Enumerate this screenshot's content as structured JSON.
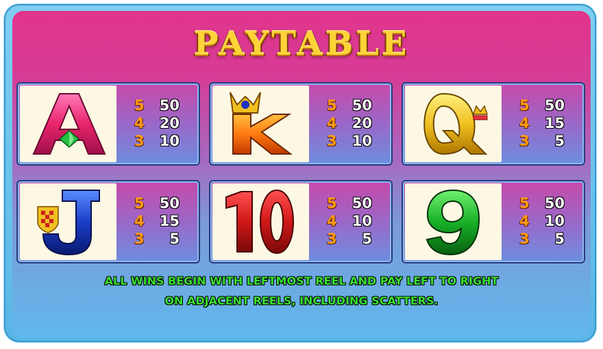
{
  "title": "PAYTABLE",
  "symbols": [
    {
      "name": "A",
      "icon": "ace-icon",
      "color": "#e8246c",
      "pays": [
        {
          "count": "5",
          "amount": "50"
        },
        {
          "count": "4",
          "amount": "20"
        },
        {
          "count": "3",
          "amount": "10"
        }
      ]
    },
    {
      "name": "K",
      "icon": "king-icon",
      "color": "#ff7a10",
      "pays": [
        {
          "count": "5",
          "amount": "50"
        },
        {
          "count": "4",
          "amount": "20"
        },
        {
          "count": "3",
          "amount": "10"
        }
      ]
    },
    {
      "name": "Q",
      "icon": "queen-icon",
      "color": "#f0c020",
      "pays": [
        {
          "count": "5",
          "amount": "50"
        },
        {
          "count": "4",
          "amount": "15"
        },
        {
          "count": "3",
          "amount": "5"
        }
      ]
    },
    {
      "name": "J",
      "icon": "jack-icon",
      "color": "#1a3cc8",
      "pays": [
        {
          "count": "5",
          "amount": "50"
        },
        {
          "count": "4",
          "amount": "15"
        },
        {
          "count": "3",
          "amount": "5"
        }
      ]
    },
    {
      "name": "10",
      "icon": "ten-icon",
      "color": "#d01818",
      "pays": [
        {
          "count": "5",
          "amount": "50"
        },
        {
          "count": "4",
          "amount": "10"
        },
        {
          "count": "3",
          "amount": "5"
        }
      ]
    },
    {
      "name": "9",
      "icon": "nine-icon",
      "color": "#18b028",
      "pays": [
        {
          "count": "5",
          "amount": "50"
        },
        {
          "count": "4",
          "amount": "10"
        },
        {
          "count": "3",
          "amount": "5"
        }
      ]
    }
  ],
  "footer": {
    "line1": "ALL WINS BEGIN WITH LEFTMOST REEL AND PAY LEFT TO RIGHT",
    "line2": "ON ADJACENT REELS, INCLUDING SCATTERS."
  }
}
